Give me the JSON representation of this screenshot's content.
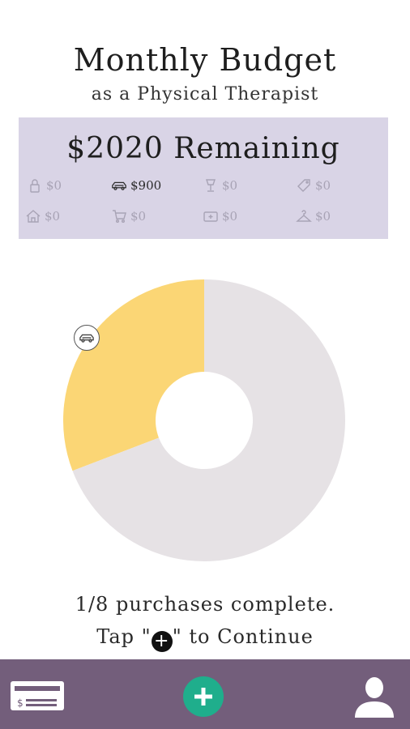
{
  "header": {
    "title": "Monthly Budget",
    "subtitle": "as a Physical Therapist"
  },
  "budget": {
    "remaining_label": "$2020 Remaining",
    "categories": [
      {
        "icon": "lock-icon",
        "amount": "$0",
        "active": false
      },
      {
        "icon": "car-icon",
        "amount": "$900",
        "active": true
      },
      {
        "icon": "lamp-icon",
        "amount": "$0",
        "active": false
      },
      {
        "icon": "tag-icon",
        "amount": "$0",
        "active": false
      },
      {
        "icon": "home-icon",
        "amount": "$0",
        "active": false
      },
      {
        "icon": "cart-icon",
        "amount": "$0",
        "active": false
      },
      {
        "icon": "medical-icon",
        "amount": "$0",
        "active": false
      },
      {
        "icon": "hanger-icon",
        "amount": "$0",
        "active": false
      }
    ]
  },
  "chart_data": {
    "type": "pie",
    "slices": [
      {
        "label": "car",
        "value": 900,
        "color": "#fbd675"
      },
      {
        "label": "remaining",
        "value": 2020,
        "color": "#e6e2e5"
      }
    ]
  },
  "footer_text": {
    "progress": "1/8 purchases complete.",
    "continue_prefix": "Tap \"",
    "continue_suffix": "\" to Continue",
    "plus_glyph": "+"
  },
  "bottom_bar": {
    "color": "#735e7b",
    "wallet_icon": "wallet-icon",
    "add_icon": "plus-icon",
    "add_color": "#1fae8c",
    "profile_icon": "profile-icon"
  }
}
